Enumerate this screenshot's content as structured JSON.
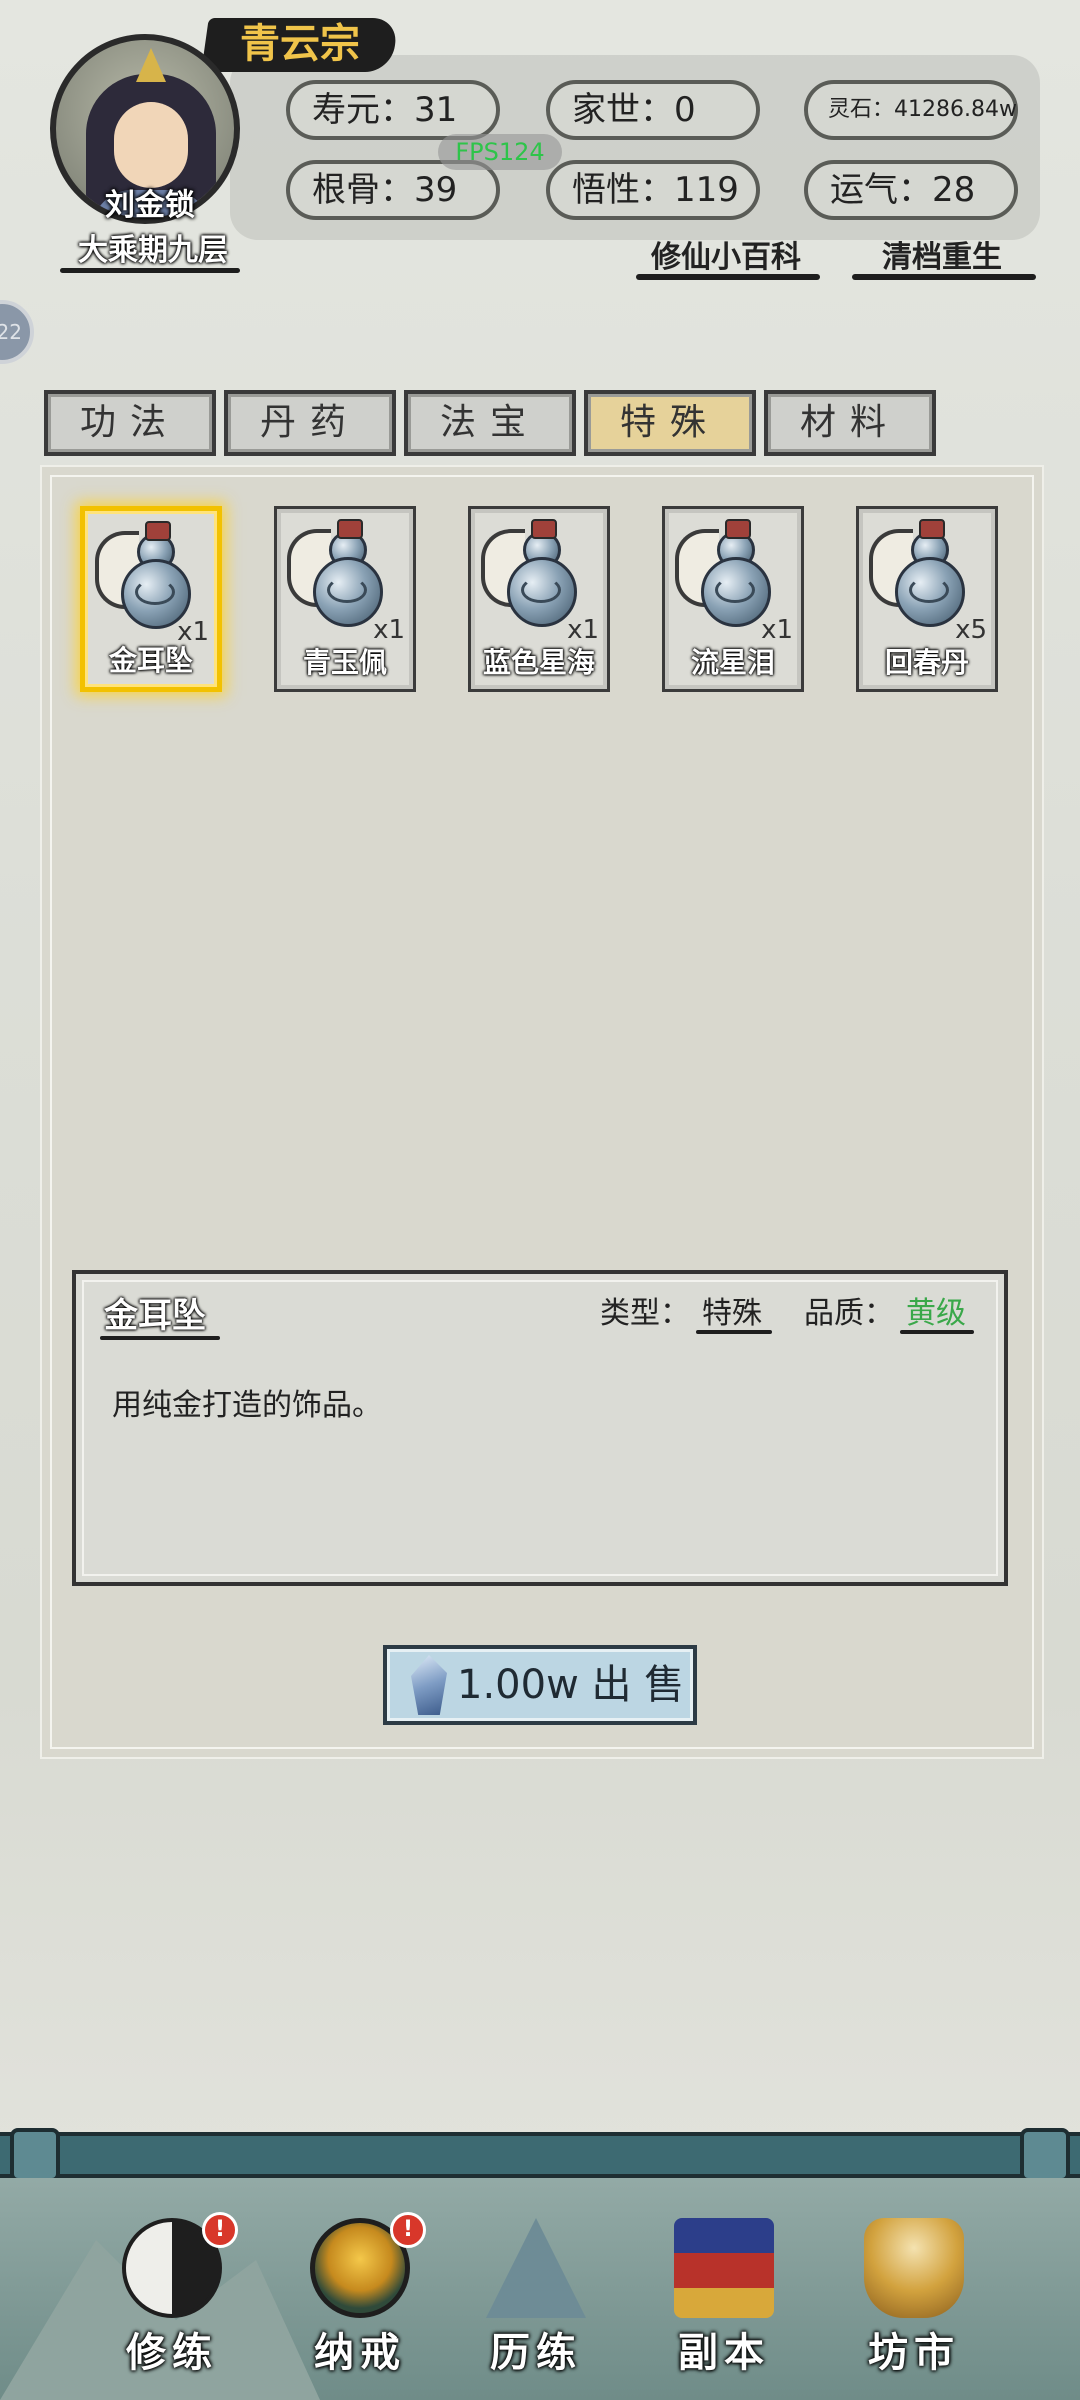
{
  "header": {
    "sect": "青云宗",
    "player_name": "刘金锁",
    "realm": "大乘期九层",
    "fps": "FPS124",
    "stats": {
      "lifespan": "寿元：31",
      "family": "家世：0",
      "spirit_stones": "灵石：41286.84w",
      "root_bone": "根骨：39",
      "comprehension": "悟性：119",
      "luck": "运气：28"
    },
    "links": {
      "encyclopedia": "修仙小百科",
      "reset": "清档重生"
    },
    "side_tab": "22"
  },
  "tabs": [
    {
      "label": "功法",
      "active": false
    },
    {
      "label": "丹药",
      "active": false
    },
    {
      "label": "法宝",
      "active": false
    },
    {
      "label": "特殊",
      "active": true
    },
    {
      "label": "材料",
      "active": false
    }
  ],
  "inventory": [
    {
      "name": "金耳坠",
      "count": "x1",
      "selected": true
    },
    {
      "name": "青玉佩",
      "count": "x1",
      "selected": false
    },
    {
      "name": "蓝色星海",
      "count": "x1",
      "selected": false
    },
    {
      "name": "流星泪",
      "count": "x1",
      "selected": false
    },
    {
      "name": "回春丹",
      "count": "x5",
      "selected": false
    }
  ],
  "detail": {
    "title": "金耳坠",
    "type_label": "类型：",
    "type_value": "特殊",
    "quality_label": "品质：",
    "quality_value": "黄级",
    "description": "用纯金打造的饰品。"
  },
  "sell_button": "1.00w 出 售",
  "bottom_nav": [
    {
      "label": "修练",
      "icon": "yin-yang-icon",
      "badge": "!"
    },
    {
      "label": "纳戒",
      "icon": "ring-icon",
      "badge": "!"
    },
    {
      "label": "历练",
      "icon": "mountain-icon",
      "badge": ""
    },
    {
      "label": "副本",
      "icon": "pavilion-icon",
      "badge": ""
    },
    {
      "label": "坊市",
      "icon": "incense-burner-icon",
      "badge": ""
    }
  ],
  "colors": {
    "accent_gold": "#f0c44a",
    "active_tab": "#e6d29a",
    "quality_green": "#3aa84a",
    "fps_green": "#2ec44a",
    "badge_red": "#d8372a"
  }
}
